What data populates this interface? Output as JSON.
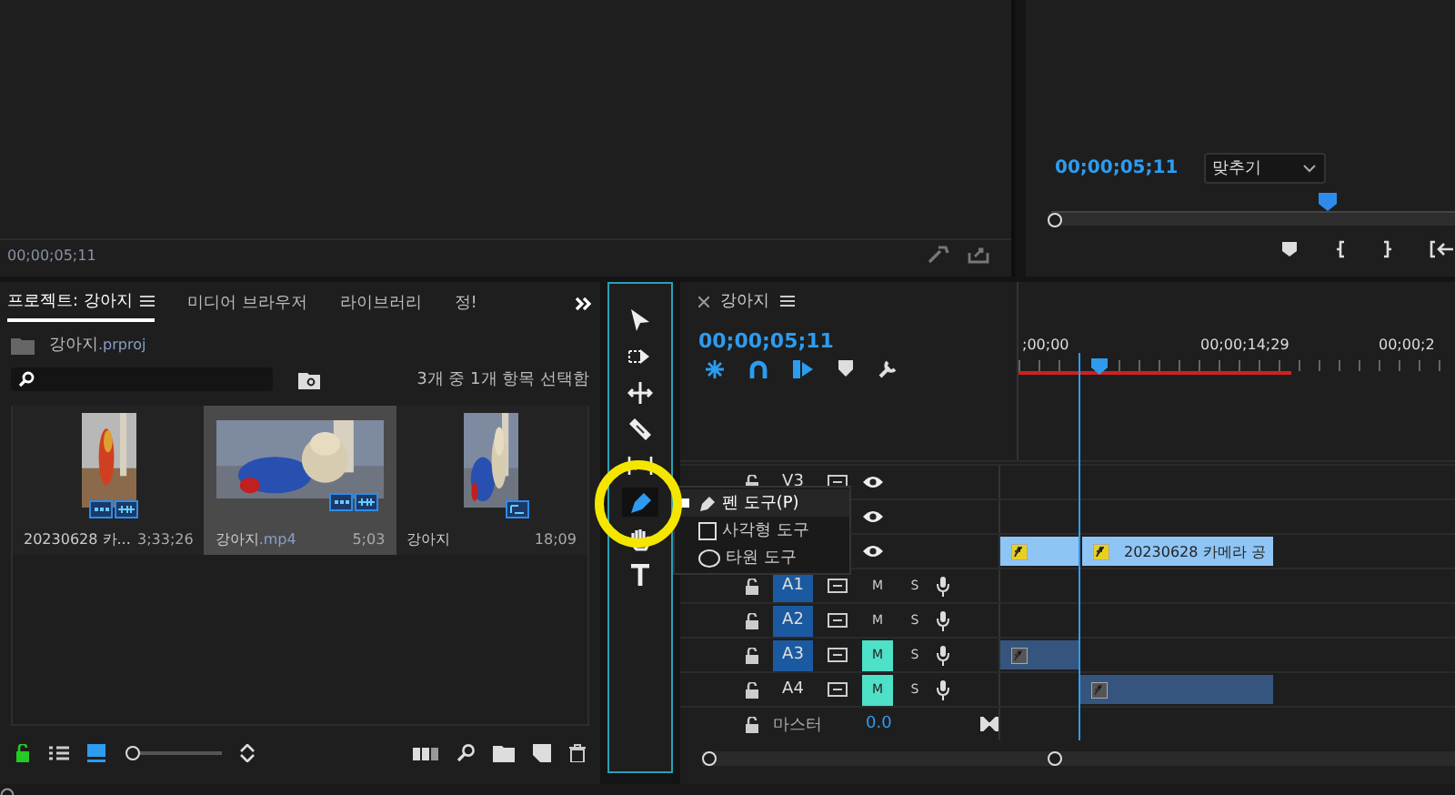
{
  "source_monitor": {
    "timecode": "00;00;05;11"
  },
  "program_monitor": {
    "timecode": "00;00;05;11",
    "zoom": "맞추기"
  },
  "project": {
    "tabs": [
      {
        "label": "프로젝트: 강아지",
        "selected": true
      },
      {
        "label": "미디어 브라우저",
        "selected": false
      },
      {
        "label": "라이브러리",
        "selected": false
      },
      {
        "label": "정!",
        "selected": false
      }
    ],
    "zoom_slider": {
      "level": 0
    },
    "file_name": "강아지",
    "file_ext": ".prproj",
    "selection_status": "3개 중 1개 항목 선택함",
    "items": [
      {
        "name": "20230628 카...",
        "duration": "3;33;26",
        "kind": "clip",
        "selected": false
      },
      {
        "name": "강아지",
        "ext": ".mp4",
        "duration": "5;03",
        "kind": "clip",
        "selected": true
      },
      {
        "name": "강아지",
        "duration": "18;09",
        "kind": "sequence",
        "selected": false
      }
    ]
  },
  "tools": [
    {
      "kind": "selection",
      "selected": false
    },
    {
      "kind": "track-select",
      "selected": false
    },
    {
      "kind": "ripple",
      "selected": false
    },
    {
      "kind": "razor",
      "selected": false
    },
    {
      "kind": "slip",
      "selected": false
    },
    {
      "kind": "pen",
      "selected": true
    },
    {
      "kind": "hand",
      "selected": false
    },
    {
      "kind": "type",
      "selected": false
    }
  ],
  "tool_menu": [
    {
      "label": "펜 도구(P)",
      "kind": "pen",
      "selected": true
    },
    {
      "label": "사각형 도구",
      "kind": "rectangle",
      "selected": false
    },
    {
      "label": "타원 도구",
      "kind": "ellipse",
      "selected": false
    }
  ],
  "timeline": {
    "title": "강아지",
    "timecode": "00;00;05;11",
    "ruler_labels": [
      ";00;00",
      "00;00;14;29",
      "00;00;2"
    ],
    "tracks": [
      {
        "kind": "video",
        "name": "V3"
      },
      {
        "kind": "video"
      },
      {
        "kind": "video",
        "clips": [
          {
            "kind": "video"
          },
          {
            "kind": "video",
            "label": "20230628 카메라 공"
          }
        ]
      },
      {
        "kind": "audio",
        "name": "A1",
        "targeted": true,
        "muted": false,
        "mute_label": "M",
        "solo_label": "S"
      },
      {
        "kind": "audio",
        "name": "A2",
        "targeted": true,
        "muted": false,
        "mute_label": "M",
        "solo_label": "S"
      },
      {
        "kind": "audio",
        "name": "A3",
        "targeted": true,
        "muted": true,
        "mute_label": "M",
        "solo_label": "S",
        "clips": [
          {
            "kind": "audio"
          }
        ]
      },
      {
        "kind": "audio",
        "name": "A4",
        "targeted": false,
        "muted": true,
        "mute_label": "M",
        "solo_label": "S",
        "clips": [
          {
            "kind": "audio",
            "late": true
          }
        ]
      },
      {
        "kind": "master",
        "name": "마스터",
        "value": "0.0"
      }
    ]
  }
}
